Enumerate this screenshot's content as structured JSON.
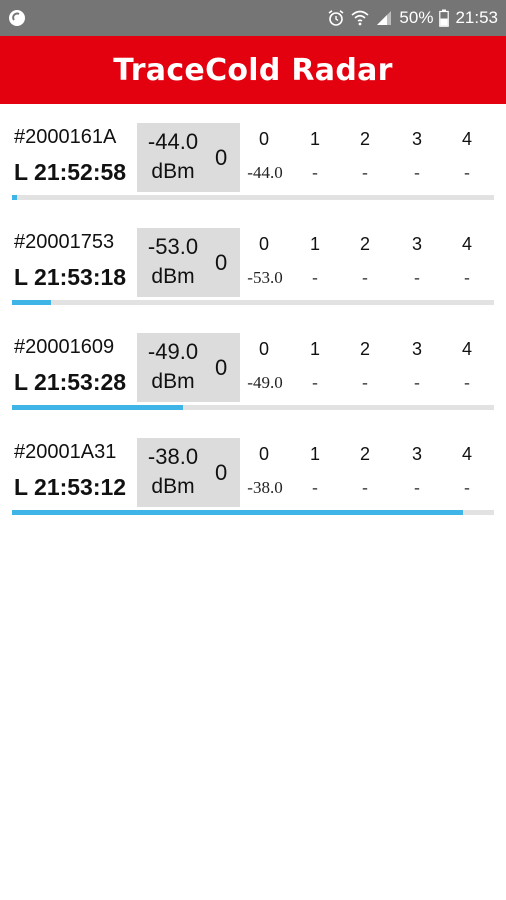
{
  "status_bar": {
    "battery_percent": "50%",
    "time": "21:53",
    "icons": [
      "app-notification-icon",
      "alarm-icon",
      "wifi-icon",
      "signal-icon",
      "battery-icon"
    ]
  },
  "app_bar": {
    "title": "TraceCold Radar"
  },
  "colors": {
    "app_bar": "#e3000f",
    "status_bar": "#757575",
    "progress": "#3fb4e6",
    "rssi_box": "#dcdcdc"
  },
  "channel_headers": [
    "0",
    "1",
    "2",
    "3",
    "4"
  ],
  "devices": [
    {
      "id": "#2000161A",
      "last_seen": "L 21:52:58",
      "rssi": "-44.0",
      "unit": "dBm",
      "channel": "0",
      "values": [
        "-44.0",
        "-",
        "-",
        "-",
        "-"
      ],
      "progress": 0.01
    },
    {
      "id": "#20001753",
      "last_seen": "L 21:53:18",
      "rssi": "-53.0",
      "unit": "dBm",
      "channel": "0",
      "values": [
        "-53.0",
        "-",
        "-",
        "-",
        "-"
      ],
      "progress": 0.08
    },
    {
      "id": "#20001609",
      "last_seen": "L 21:53:28",
      "rssi": "-49.0",
      "unit": "dBm",
      "channel": "0",
      "values": [
        "-49.0",
        "-",
        "-",
        "-",
        "-"
      ],
      "progress": 0.355
    },
    {
      "id": "#20001A31",
      "last_seen": "L 21:53:12",
      "rssi": "-38.0",
      "unit": "dBm",
      "channel": "0",
      "values": [
        "-38.0",
        "-",
        "-",
        "-",
        "-"
      ],
      "progress": 0.935
    }
  ]
}
